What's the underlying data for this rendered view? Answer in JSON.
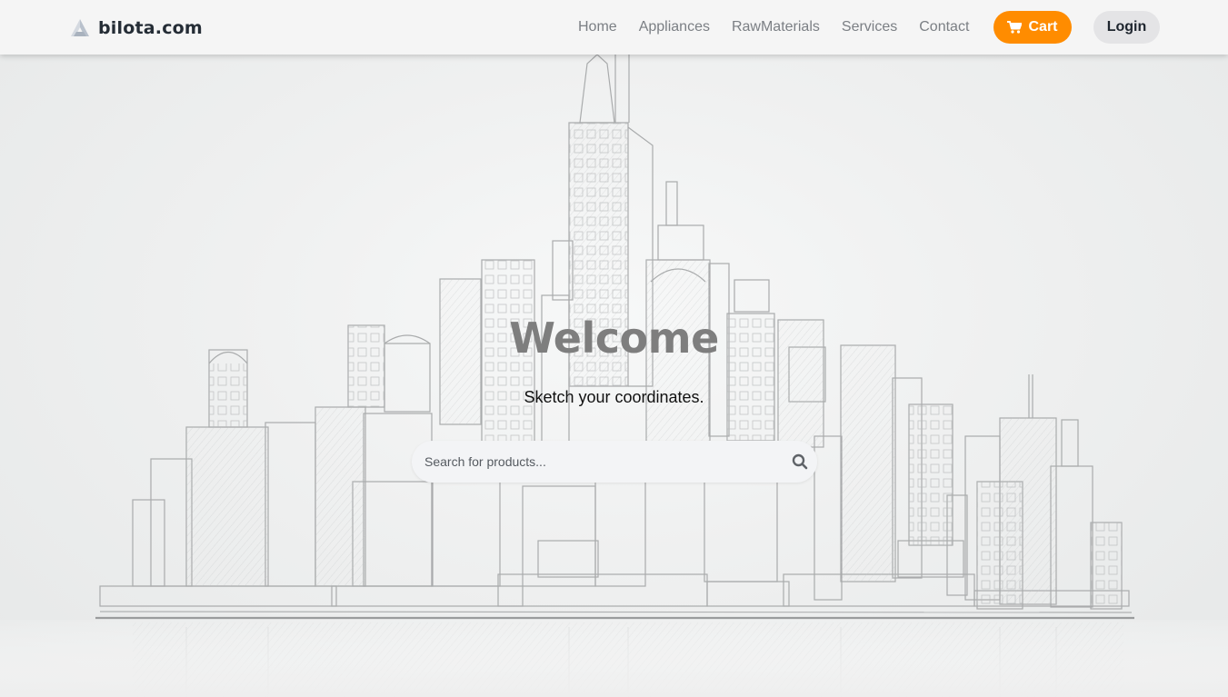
{
  "brand": {
    "name": "bilota.com",
    "logo_icon": "triangle-logo-icon"
  },
  "nav": {
    "links": [
      "Home",
      "Appliances",
      "RawMaterials",
      "Services",
      "Contact"
    ],
    "cart_label": "Cart",
    "cart_icon": "shopping-cart-icon",
    "login_label": "Login"
  },
  "hero": {
    "title": "Welcome",
    "subtitle": "Sketch your coordinates.",
    "background": "city-skyline-sketch"
  },
  "search": {
    "placeholder": "Search for products...",
    "value": "",
    "icon": "search-icon"
  },
  "colors": {
    "accent": "#ff8c00",
    "nav_bg": "#f5f5f5",
    "login_bg": "#e4e4e6"
  }
}
